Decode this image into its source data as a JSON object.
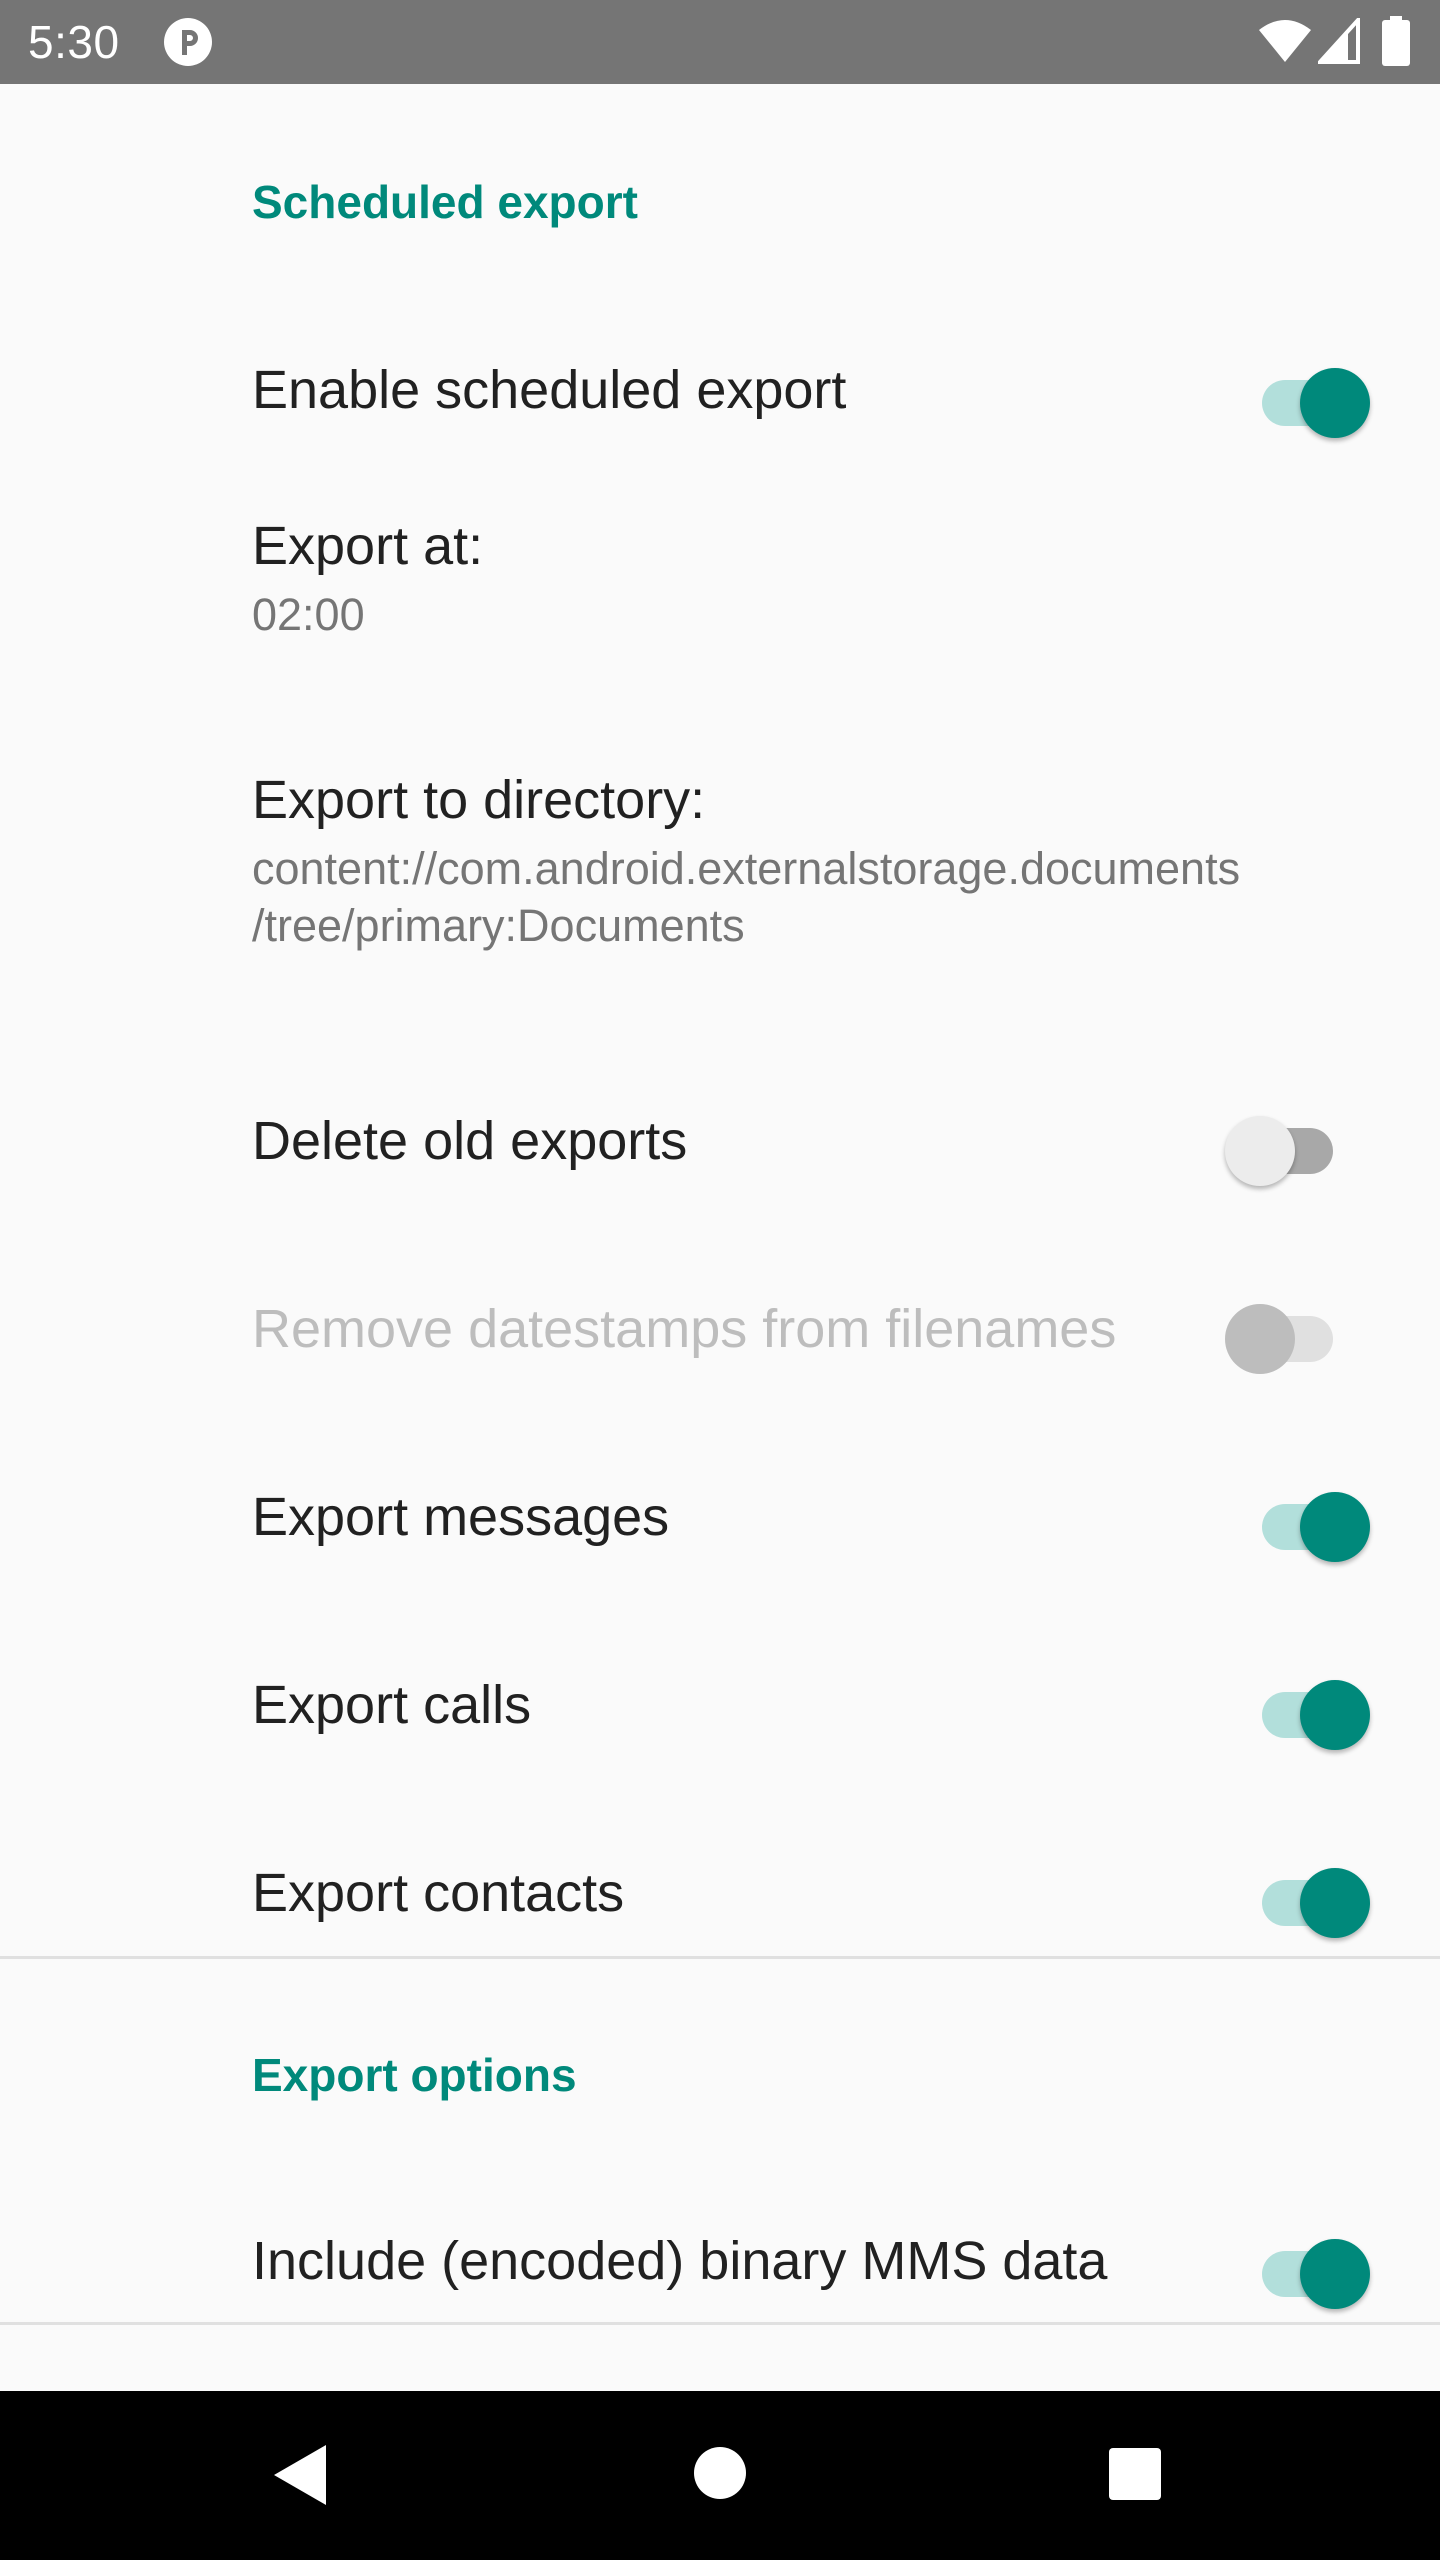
{
  "status_bar": {
    "time": "5:30"
  },
  "sections": {
    "scheduled": {
      "title": "Scheduled export",
      "enable_scheduled_export": {
        "label": "Enable scheduled export",
        "checked": true
      },
      "export_at": {
        "label": "Export at:",
        "value": "02:00"
      },
      "export_dir": {
        "label": "Export to directory:",
        "value_line1": "content://com.android.externalstorage.documents",
        "value_line2": "/tree/primary:Documents"
      },
      "delete_old_exports": {
        "label": "Delete old exports",
        "checked": false
      },
      "remove_datestamps": {
        "label": "Remove datestamps from filenames",
        "checked": false,
        "enabled": false
      },
      "export_messages": {
        "label": "Export messages",
        "checked": true
      },
      "export_calls": {
        "label": "Export calls",
        "checked": true
      },
      "export_contacts": {
        "label": "Export contacts",
        "checked": true
      }
    },
    "options": {
      "title": "Export options",
      "include_binary_mms": {
        "label": "Include (encoded) binary MMS data",
        "checked": true
      }
    }
  },
  "colors": {
    "accent": "#00897b",
    "switch_track_on": "#b2dfdb",
    "status_bar": "#757575",
    "nav_bar": "#000000",
    "background": "#fafafa"
  },
  "icons": {
    "status_app": "app-notification-icon",
    "wifi": "wifi-icon",
    "signal": "signal-icon",
    "battery": "battery-icon",
    "back": "back-icon",
    "home": "home-icon",
    "recents": "recents-icon"
  }
}
